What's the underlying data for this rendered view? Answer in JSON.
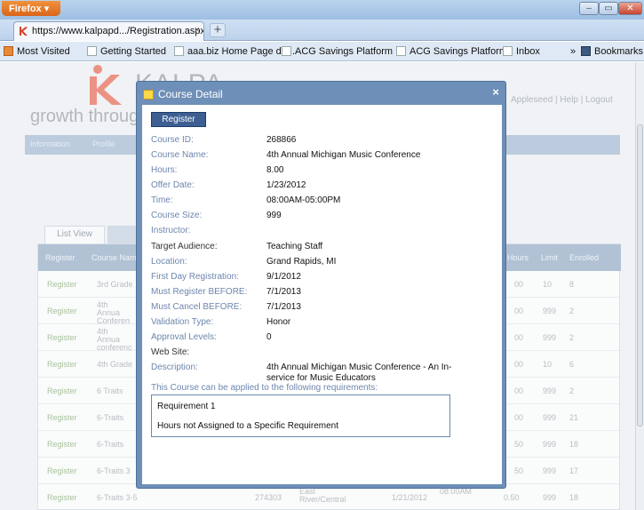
{
  "browser": {
    "app_button": "Firefox ▾",
    "tab_title": "https://www.kalpapd.../Registration.aspx#",
    "bookmarks": [
      "Most Visited",
      "Getting Started",
      "aaa.biz Home Page de...",
      "ACG Savings Platform ...",
      "ACG Savings Platform",
      "Inbox"
    ],
    "bookmarks_overflow": "»",
    "bookmarks_menu": "Bookmarks"
  },
  "page": {
    "logo_text": "K",
    "logo_suffix": "KALPA",
    "tagline": "growth throug",
    "top_links": "Appleseed | Help | Logout",
    "nav_items": [
      "Information",
      "Profile"
    ],
    "tab_list_view": "List View",
    "grid_headers": [
      "Register",
      "Course Name",
      "Hours",
      "Limit",
      "Enrolled"
    ],
    "grid_rows": [
      {
        "reg": "Register",
        "name": "3rd Grade",
        "hours": "00",
        "limit": "10",
        "enrolled": "8"
      },
      {
        "reg": "Register",
        "name": "4th Annua Conferen",
        "hours": "00",
        "limit": "999",
        "enrolled": "2"
      },
      {
        "reg": "Register",
        "name": "4th Annua conferenc",
        "hours": "00",
        "limit": "999",
        "enrolled": "2"
      },
      {
        "reg": "Register",
        "name": "4th Grade",
        "hours": "00",
        "limit": "10",
        "enrolled": "6"
      },
      {
        "reg": "Register",
        "name": "6 Traits",
        "hours": "00",
        "limit": "999",
        "enrolled": "2"
      },
      {
        "reg": "Register",
        "name": "6-Traits",
        "hours": "00",
        "limit": "999",
        "enrolled": "21"
      },
      {
        "reg": "Register",
        "name": "6-Traits",
        "hours": "50",
        "limit": "999",
        "enrolled": "18"
      },
      {
        "reg": "Register",
        "name": "6-Traits 3",
        "hours": "50",
        "limit": "999",
        "enrolled": "17"
      },
      {
        "reg": "Register",
        "name": "6-Traits 3-5",
        "id": "274303",
        "loc": "East River/Central",
        "date": "1/21/2012",
        "time": "08:00AM",
        "hours": "0.50",
        "limit": "999",
        "enrolled": "18"
      }
    ]
  },
  "dialog": {
    "title": "Course Detail",
    "close": "×",
    "register_button": "Register",
    "fields": [
      {
        "label": "Course ID:",
        "value": "268866",
        "dark": false
      },
      {
        "label": "Course Name:",
        "value": "4th Annual Michigan Music Conference",
        "dark": false
      },
      {
        "label": "Hours:",
        "value": "8.00",
        "dark": false
      },
      {
        "label": "Offer Date:",
        "value": "1/23/2012",
        "dark": false
      },
      {
        "label": "Time:",
        "value": "08:00AM-05:00PM",
        "dark": false
      },
      {
        "label": "Course Size:",
        "value": "999",
        "dark": false
      },
      {
        "label": "Instructor:",
        "value": "",
        "dark": false
      },
      {
        "label": "Target Audience:",
        "value": "Teaching Staff",
        "dark": true
      },
      {
        "label": "Location:",
        "value": "Grand Rapids, MI",
        "dark": false
      },
      {
        "label": "First Day Registration:",
        "value": "9/1/2012",
        "dark": false
      },
      {
        "label": "Must Register BEFORE:",
        "value": "7/1/2013",
        "dark": false
      },
      {
        "label": "Must Cancel BEFORE:",
        "value": "7/1/2013",
        "dark": false
      },
      {
        "label": "Validation Type:",
        "value": "Honor",
        "dark": false
      },
      {
        "label": "Approval Levels:",
        "value": "0",
        "dark": false
      },
      {
        "label": "Web Site:",
        "value": "",
        "dark": true
      },
      {
        "label": "Description:",
        "value": "4th Annual Michigan Music Conference - An In-service for Music Educators",
        "dark": false
      }
    ],
    "applies_text": "This Course can be applied to the following requirements:",
    "requirements": [
      "Requirement 1",
      "Hours not Assigned to a Specific Requirement"
    ]
  },
  "colors": {
    "accent": "#6e8fb8",
    "label": "#6d86ad",
    "button": "#3d5f92",
    "logo": "#e04a33"
  }
}
